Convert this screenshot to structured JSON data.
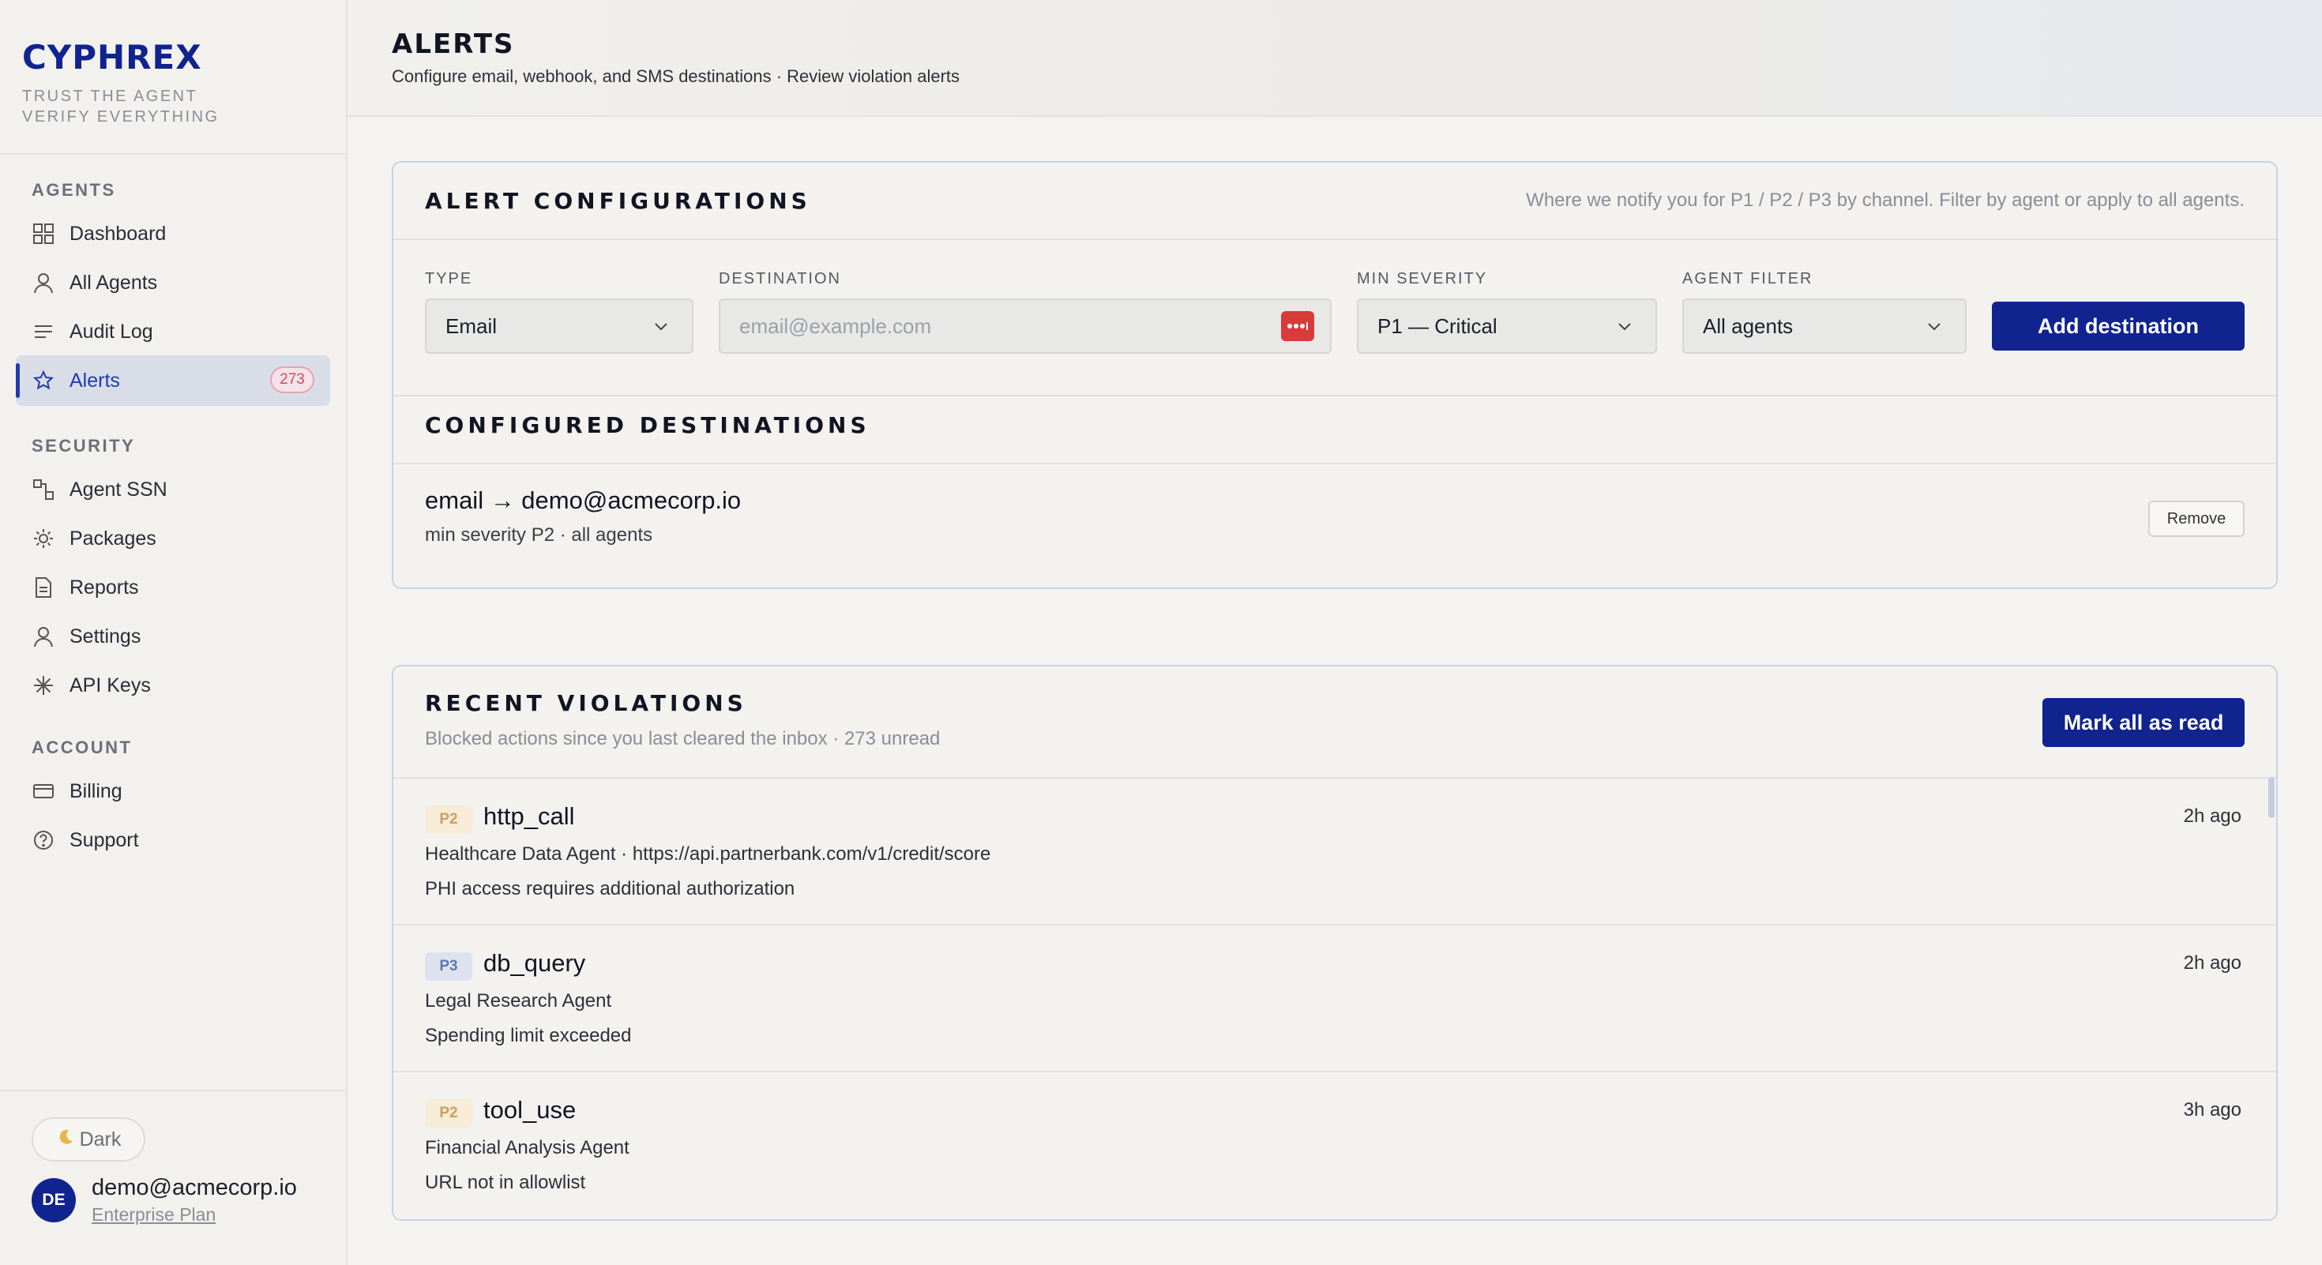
{
  "brand": {
    "name": "CYPHREX",
    "tagline_1": "TRUST THE AGENT",
    "tagline_2": "VERIFY EVERYTHING"
  },
  "sidebar": {
    "sections": {
      "agents": "AGENTS",
      "security": "SECURITY",
      "account": "ACCOUNT"
    },
    "items": [
      {
        "label": "Dashboard",
        "icon": "grid-icon"
      },
      {
        "label": "All Agents",
        "icon": "person-icon"
      },
      {
        "label": "Audit Log",
        "icon": "list-icon"
      },
      {
        "label": "Alerts",
        "icon": "star-icon",
        "badge": "273",
        "active": true
      },
      {
        "label": "Agent SSN",
        "icon": "nodes-icon"
      },
      {
        "label": "Packages",
        "icon": "sun-icon"
      },
      {
        "label": "Reports",
        "icon": "document-icon"
      },
      {
        "label": "Settings",
        "icon": "person-icon"
      },
      {
        "label": "API Keys",
        "icon": "asterisk-icon"
      },
      {
        "label": "Billing",
        "icon": "card-icon"
      },
      {
        "label": "Support",
        "icon": "help-icon"
      }
    ],
    "theme_toggle": "Dark",
    "user": {
      "initials": "DE",
      "email": "demo@acmecorp.io",
      "plan": "Enterprise Plan"
    }
  },
  "header": {
    "title": "ALERTS",
    "subtitle": "Configure email, webhook, and SMS destinations · Review violation alerts"
  },
  "alert_config": {
    "title": "ALERT CONFIGURATIONS",
    "hint": "Where we notify you for P1 / P2 / P3 by channel. Filter by agent or apply to all agents.",
    "type_label": "TYPE",
    "type_value": "Email",
    "destination_label": "DESTINATION",
    "destination_placeholder": "email@example.com",
    "severity_label": "MIN SEVERITY",
    "severity_value": "P1 — Critical",
    "agent_filter_label": "AGENT FILTER",
    "agent_filter_value": "All agents",
    "add_button": "Add destination",
    "configured_title": "CONFIGURED DESTINATIONS",
    "destinations": [
      {
        "title": "email → demo@acmecorp.io",
        "meta": "min severity P2 · all agents",
        "remove": "Remove"
      }
    ]
  },
  "violations": {
    "title": "RECENT VIOLATIONS",
    "subtitle": "Blocked actions since you last cleared the inbox · 273 unread",
    "mark_all": "Mark all as read",
    "items": [
      {
        "severity": "P2",
        "action": "http_call",
        "source": "Healthcare Data Agent · https://api.partnerbank.com/v1/credit/score",
        "reason": "PHI access requires additional authorization",
        "time": "2h ago"
      },
      {
        "severity": "P3",
        "action": "db_query",
        "source": "Legal Research Agent",
        "reason": "Spending limit exceeded",
        "time": "2h ago"
      },
      {
        "severity": "P2",
        "action": "tool_use",
        "source": "Financial Analysis Agent",
        "reason": "URL not in allowlist",
        "time": "3h ago"
      }
    ]
  },
  "colors": {
    "brand": "#10238f",
    "accent": "#1f3bb0",
    "badge": "#d24a64",
    "p2": "#c9a25a",
    "p3": "#5d78b0"
  }
}
